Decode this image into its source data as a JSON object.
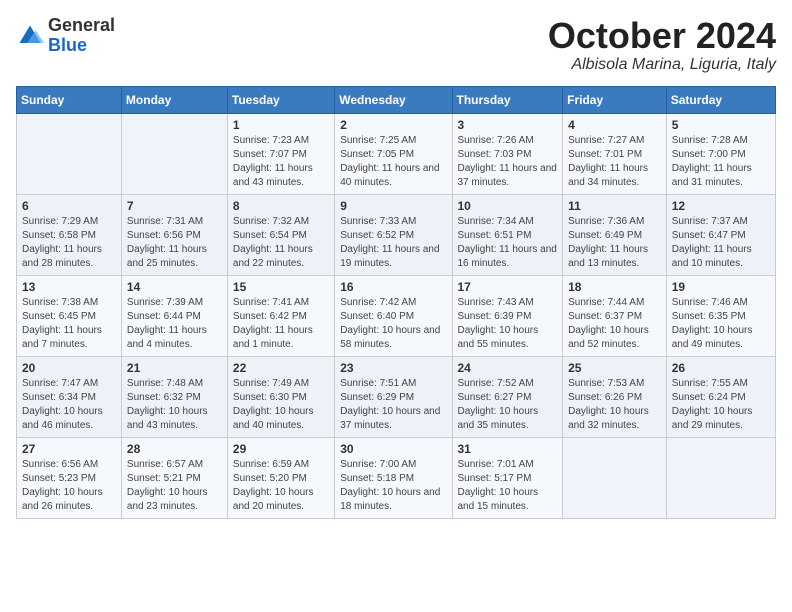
{
  "logo": {
    "general": "General",
    "blue": "Blue"
  },
  "header": {
    "month": "October 2024",
    "location": "Albisola Marina, Liguria, Italy"
  },
  "weekdays": [
    "Sunday",
    "Monday",
    "Tuesday",
    "Wednesday",
    "Thursday",
    "Friday",
    "Saturday"
  ],
  "weeks": [
    [
      {
        "day": "",
        "info": ""
      },
      {
        "day": "",
        "info": ""
      },
      {
        "day": "1",
        "info": "Sunrise: 7:23 AM\nSunset: 7:07 PM\nDaylight: 11 hours and 43 minutes."
      },
      {
        "day": "2",
        "info": "Sunrise: 7:25 AM\nSunset: 7:05 PM\nDaylight: 11 hours and 40 minutes."
      },
      {
        "day": "3",
        "info": "Sunrise: 7:26 AM\nSunset: 7:03 PM\nDaylight: 11 hours and 37 minutes."
      },
      {
        "day": "4",
        "info": "Sunrise: 7:27 AM\nSunset: 7:01 PM\nDaylight: 11 hours and 34 minutes."
      },
      {
        "day": "5",
        "info": "Sunrise: 7:28 AM\nSunset: 7:00 PM\nDaylight: 11 hours and 31 minutes."
      }
    ],
    [
      {
        "day": "6",
        "info": "Sunrise: 7:29 AM\nSunset: 6:58 PM\nDaylight: 11 hours and 28 minutes."
      },
      {
        "day": "7",
        "info": "Sunrise: 7:31 AM\nSunset: 6:56 PM\nDaylight: 11 hours and 25 minutes."
      },
      {
        "day": "8",
        "info": "Sunrise: 7:32 AM\nSunset: 6:54 PM\nDaylight: 11 hours and 22 minutes."
      },
      {
        "day": "9",
        "info": "Sunrise: 7:33 AM\nSunset: 6:52 PM\nDaylight: 11 hours and 19 minutes."
      },
      {
        "day": "10",
        "info": "Sunrise: 7:34 AM\nSunset: 6:51 PM\nDaylight: 11 hours and 16 minutes."
      },
      {
        "day": "11",
        "info": "Sunrise: 7:36 AM\nSunset: 6:49 PM\nDaylight: 11 hours and 13 minutes."
      },
      {
        "day": "12",
        "info": "Sunrise: 7:37 AM\nSunset: 6:47 PM\nDaylight: 11 hours and 10 minutes."
      }
    ],
    [
      {
        "day": "13",
        "info": "Sunrise: 7:38 AM\nSunset: 6:45 PM\nDaylight: 11 hours and 7 minutes."
      },
      {
        "day": "14",
        "info": "Sunrise: 7:39 AM\nSunset: 6:44 PM\nDaylight: 11 hours and 4 minutes."
      },
      {
        "day": "15",
        "info": "Sunrise: 7:41 AM\nSunset: 6:42 PM\nDaylight: 11 hours and 1 minute."
      },
      {
        "day": "16",
        "info": "Sunrise: 7:42 AM\nSunset: 6:40 PM\nDaylight: 10 hours and 58 minutes."
      },
      {
        "day": "17",
        "info": "Sunrise: 7:43 AM\nSunset: 6:39 PM\nDaylight: 10 hours and 55 minutes."
      },
      {
        "day": "18",
        "info": "Sunrise: 7:44 AM\nSunset: 6:37 PM\nDaylight: 10 hours and 52 minutes."
      },
      {
        "day": "19",
        "info": "Sunrise: 7:46 AM\nSunset: 6:35 PM\nDaylight: 10 hours and 49 minutes."
      }
    ],
    [
      {
        "day": "20",
        "info": "Sunrise: 7:47 AM\nSunset: 6:34 PM\nDaylight: 10 hours and 46 minutes."
      },
      {
        "day": "21",
        "info": "Sunrise: 7:48 AM\nSunset: 6:32 PM\nDaylight: 10 hours and 43 minutes."
      },
      {
        "day": "22",
        "info": "Sunrise: 7:49 AM\nSunset: 6:30 PM\nDaylight: 10 hours and 40 minutes."
      },
      {
        "day": "23",
        "info": "Sunrise: 7:51 AM\nSunset: 6:29 PM\nDaylight: 10 hours and 37 minutes."
      },
      {
        "day": "24",
        "info": "Sunrise: 7:52 AM\nSunset: 6:27 PM\nDaylight: 10 hours and 35 minutes."
      },
      {
        "day": "25",
        "info": "Sunrise: 7:53 AM\nSunset: 6:26 PM\nDaylight: 10 hours and 32 minutes."
      },
      {
        "day": "26",
        "info": "Sunrise: 7:55 AM\nSunset: 6:24 PM\nDaylight: 10 hours and 29 minutes."
      }
    ],
    [
      {
        "day": "27",
        "info": "Sunrise: 6:56 AM\nSunset: 5:23 PM\nDaylight: 10 hours and 26 minutes."
      },
      {
        "day": "28",
        "info": "Sunrise: 6:57 AM\nSunset: 5:21 PM\nDaylight: 10 hours and 23 minutes."
      },
      {
        "day": "29",
        "info": "Sunrise: 6:59 AM\nSunset: 5:20 PM\nDaylight: 10 hours and 20 minutes."
      },
      {
        "day": "30",
        "info": "Sunrise: 7:00 AM\nSunset: 5:18 PM\nDaylight: 10 hours and 18 minutes."
      },
      {
        "day": "31",
        "info": "Sunrise: 7:01 AM\nSunset: 5:17 PM\nDaylight: 10 hours and 15 minutes."
      },
      {
        "day": "",
        "info": ""
      },
      {
        "day": "",
        "info": ""
      }
    ]
  ]
}
